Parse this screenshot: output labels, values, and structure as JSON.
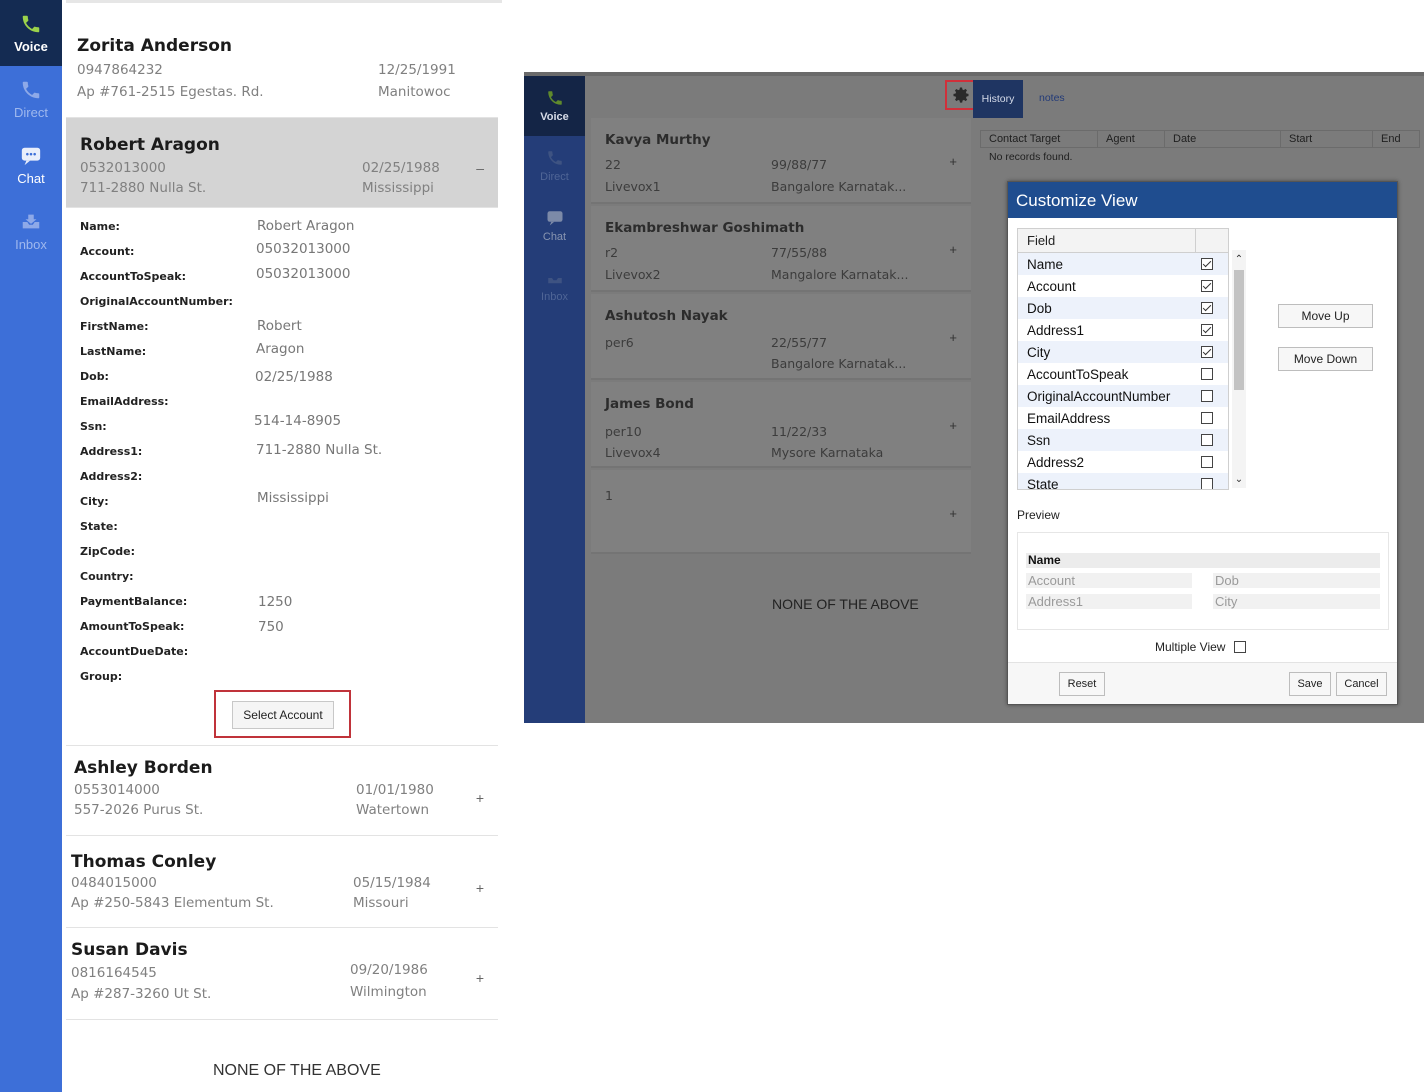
{
  "left_nav": {
    "items": [
      {
        "label": "Voice"
      },
      {
        "label": "Direct"
      },
      {
        "label": "Chat"
      },
      {
        "label": "Inbox"
      }
    ]
  },
  "left_contacts": {
    "zorita": {
      "name": "Zorita Anderson",
      "account": "0947864232",
      "address": "Ap #761-2515 Egestas. Rd.",
      "dob": "12/25/1991",
      "city": "Manitowoc"
    },
    "robert": {
      "name": "Robert Aragon",
      "account": "0532013000",
      "address": "711-2880 Nulla St.",
      "dob": "02/25/1988",
      "city": "Mississippi",
      "toggle": "–"
    },
    "ashley": {
      "name": "Ashley Borden",
      "account": "0553014000",
      "address": "557-2026 Purus St.",
      "dob": "01/01/1980",
      "city": "Watertown",
      "toggle": "+"
    },
    "thomas": {
      "name": "Thomas Conley",
      "account": "0484015000",
      "address": "Ap #250-5843 Elementum St.",
      "dob": "05/15/1984",
      "city": "Missouri",
      "toggle": "+"
    },
    "susan": {
      "name": "Susan Davis",
      "account": "0816164545",
      "address": "Ap #287-3260 Ut St.",
      "dob": "09/20/1986",
      "city": "Wilmington",
      "toggle": "+"
    }
  },
  "detail": {
    "rows": [
      {
        "label": "Name:",
        "value": "Robert Aragon"
      },
      {
        "label": "Account:",
        "value": "05032013000"
      },
      {
        "label": "AccountToSpeak:",
        "value": "05032013000"
      },
      {
        "label": "OriginalAccountNumber:",
        "value": ""
      },
      {
        "label": "FirstName:",
        "value": "Robert"
      },
      {
        "label": "LastName:",
        "value": "Aragon"
      },
      {
        "label": "Dob:",
        "value": "02/25/1988"
      },
      {
        "label": "EmailAddress:",
        "value": ""
      },
      {
        "label": "Ssn:",
        "value": "514-14-8905"
      },
      {
        "label": "Address1:",
        "value": "711-2880 Nulla St."
      },
      {
        "label": "Address2:",
        "value": ""
      },
      {
        "label": "City:",
        "value": "Mississippi"
      },
      {
        "label": "State:",
        "value": ""
      },
      {
        "label": "ZipCode:",
        "value": ""
      },
      {
        "label": "Country:",
        "value": ""
      },
      {
        "label": "PaymentBalance:",
        "value": "1250"
      },
      {
        "label": "AmountToSpeak:",
        "value": "750"
      },
      {
        "label": "AccountDueDate:",
        "value": ""
      },
      {
        "label": "Group:",
        "value": ""
      }
    ],
    "select_button": "Select Account"
  },
  "left_none": "NONE OF THE ABOVE",
  "right": {
    "nav": [
      {
        "label": "Voice"
      },
      {
        "label": "Direct"
      },
      {
        "label": "Chat"
      },
      {
        "label": "Inbox"
      }
    ],
    "contacts": [
      {
        "name": "Kavya Murthy",
        "a": "22",
        "b": "99/88/77",
        "c": "Livevox1",
        "d": "Bangalore Karnatak..."
      },
      {
        "name": "Ekambreshwar Goshimath",
        "a": "r2",
        "b": "77/55/88",
        "c": "Livevox2",
        "d": "Mangalore Karnatak..."
      },
      {
        "name": "Ashutosh Nayak",
        "a": "per6",
        "b": "22/55/77",
        "c": "",
        "d": "Bangalore Karnatak..."
      },
      {
        "name": "James Bond",
        "a": "per10",
        "b": "11/22/33",
        "c": "Livevox4",
        "d": "Mysore Karnataka"
      },
      {
        "name": "",
        "a": "1",
        "b": "",
        "c": "",
        "d": ""
      }
    ],
    "plus": "+",
    "none": "NONE OF THE ABOVE",
    "tabs": {
      "history": "History",
      "notes": "notes"
    },
    "history_columns": [
      "Contact Target",
      "Agent",
      "Date",
      "Start",
      "End"
    ],
    "history_empty": "No records found."
  },
  "dialog": {
    "title": "Customize View",
    "field_header": "Field",
    "fields": [
      {
        "name": "Name",
        "checked": true
      },
      {
        "name": "Account",
        "checked": true
      },
      {
        "name": "Dob",
        "checked": true
      },
      {
        "name": "Address1",
        "checked": true
      },
      {
        "name": "City",
        "checked": true
      },
      {
        "name": "AccountToSpeak",
        "checked": false
      },
      {
        "name": "OriginalAccountNumber",
        "checked": false
      },
      {
        "name": "EmailAddress",
        "checked": false
      },
      {
        "name": "Ssn",
        "checked": false
      },
      {
        "name": "Address2",
        "checked": false
      },
      {
        "name": "State",
        "checked": false
      }
    ],
    "move_up": "Move Up",
    "move_down": "Move Down",
    "preview_label": "Preview",
    "preview": {
      "name": "Name",
      "account": "Account",
      "dob": "Dob",
      "address1": "Address1",
      "city": "City"
    },
    "multiple_view": "Multiple View",
    "reset": "Reset",
    "save": "Save",
    "cancel": "Cancel"
  },
  "colors": {
    "nav_blue": "#3d6fd8",
    "nav_active": "#142b52",
    "dialog_title": "#1f4d8f",
    "highlight_red": "#c0333a"
  }
}
